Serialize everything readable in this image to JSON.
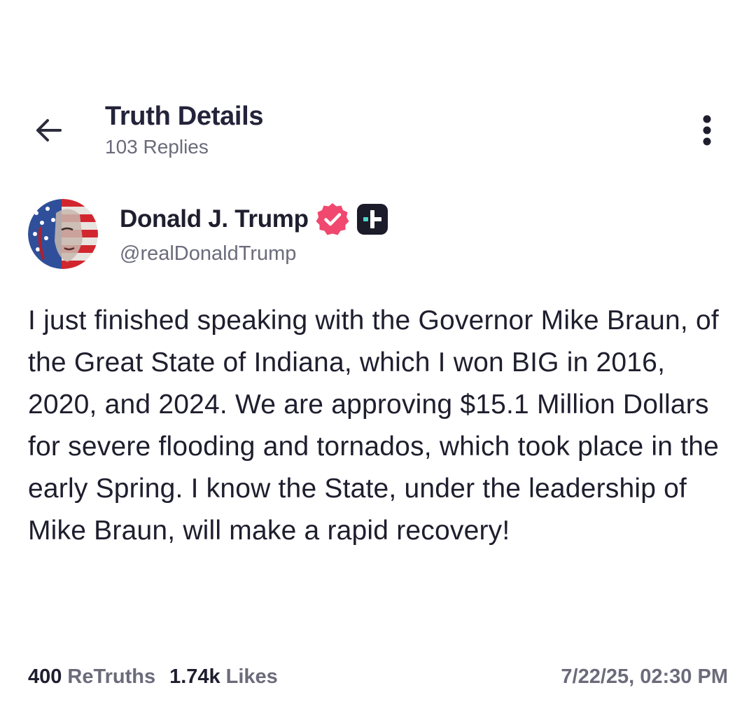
{
  "header": {
    "title": "Truth Details",
    "subtitle": "103 Replies",
    "back_icon": "arrow-left-icon",
    "more_icon": "vertical-dots-icon"
  },
  "post": {
    "author": {
      "name": "Donald J. Trump",
      "handle": "@realDonaldTrump",
      "verified_icon": "verified-badge-icon",
      "plus_icon": "plus-badge-icon",
      "verified_color": "#f0486e"
    },
    "body": "I just finished speaking with the Governor Mike Braun, of the Great State of Indiana, which I won BIG in 2016, 2020, and 2024. We are approving $15.1 Million Dollars for severe flooding and tornados, which took place in the early Spring. I know the State, under the leadership of Mike Braun, will make a rapid recovery!",
    "stats": {
      "retruths_count": "400",
      "retruths_label": "ReTruths",
      "likes_count": "1.74k",
      "likes_label": "Likes"
    },
    "timestamp": "7/22/25, 02:30 PM"
  },
  "colors": {
    "text": "#1e1e2e",
    "muted": "#6b6b7b",
    "background": "#ffffff"
  }
}
